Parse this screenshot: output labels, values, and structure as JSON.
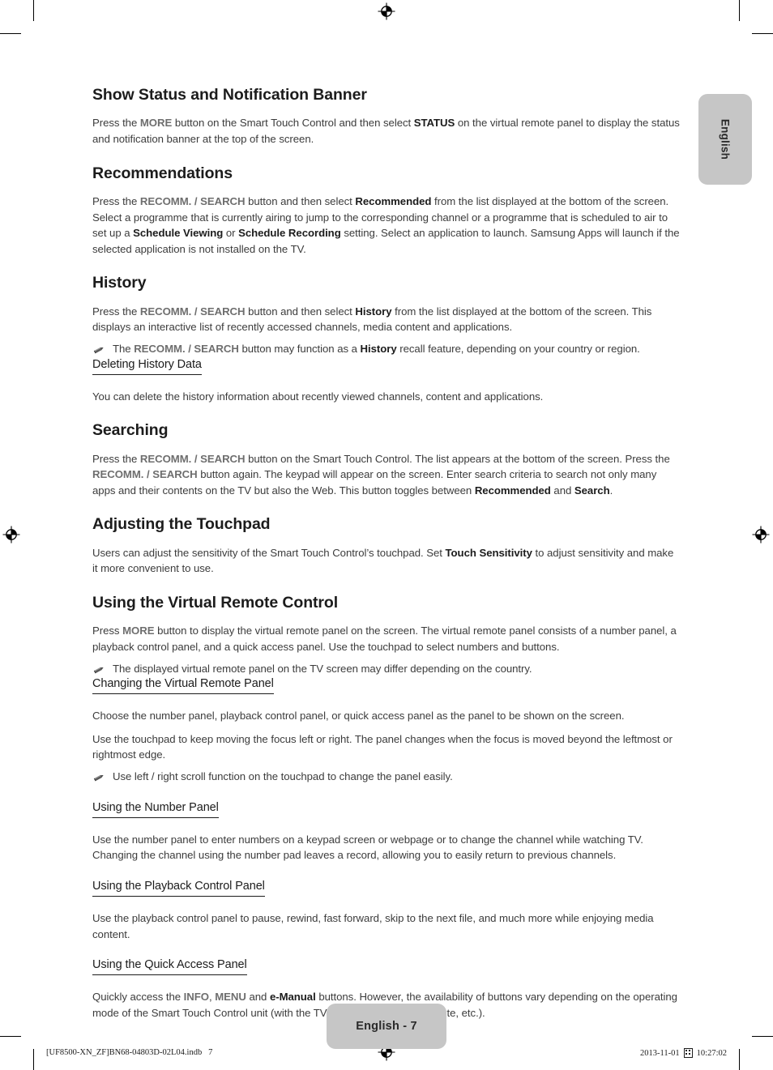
{
  "page": {
    "language_tab": "English",
    "page_badge": "English - 7",
    "imposition_left": "[UF8500-XN_ZF]BN68-04803D-02L04.indb   7",
    "imposition_date": "2013-11-01",
    "imposition_time": "10:27:02",
    "imposition_glyph": "tofu-box-glyph"
  },
  "icons": {
    "note": "note-pencil-icon",
    "registration": "registration-target-icon"
  },
  "sections": [
    {
      "id": "show-status-and-notification-banner",
      "title": "Show Status and Notification Banner",
      "paragraphs": [
        {
          "runs": [
            {
              "t": "Press the ",
              "s": "n"
            },
            {
              "t": "MORE",
              "s": "btn"
            },
            {
              "t": " button on the Smart Touch Control and then select ",
              "s": "n"
            },
            {
              "t": "STATUS",
              "s": "k"
            },
            {
              "t": " on the virtual remote panel to display the status and notification banner at the top of the screen.",
              "s": "n"
            }
          ]
        }
      ]
    },
    {
      "id": "recommendations",
      "title": "Recommendations",
      "paragraphs": [
        {
          "runs": [
            {
              "t": "Press the ",
              "s": "n"
            },
            {
              "t": "RECOMM. / SEARCH",
              "s": "btn"
            },
            {
              "t": " button and then select ",
              "s": "n"
            },
            {
              "t": "Recommended",
              "s": "k"
            },
            {
              "t": " from the list displayed at the bottom of the screen. Select a programme that is currently airing to jump to the corresponding channel or a programme that is scheduled to air to set up a ",
              "s": "n"
            },
            {
              "t": "Schedule Viewing",
              "s": "k"
            },
            {
              "t": " or ",
              "s": "n"
            },
            {
              "t": "Schedule Recording",
              "s": "k"
            },
            {
              "t": " setting. Select an application to launch. Samsung Apps will launch if the selected application is not installed on the TV.",
              "s": "n"
            }
          ]
        }
      ]
    },
    {
      "id": "history",
      "title": "History",
      "paragraphs": [
        {
          "runs": [
            {
              "t": "Press the ",
              "s": "n"
            },
            {
              "t": "RECOMM. / SEARCH",
              "s": "btn"
            },
            {
              "t": " button and then select ",
              "s": "n"
            },
            {
              "t": "History",
              "s": "k"
            },
            {
              "t": " from the list displayed at the bottom of the screen. This displays an interactive list of recently accessed channels, media content and applications.",
              "s": "n"
            }
          ]
        }
      ],
      "notes": [
        {
          "runs": [
            {
              "t": "The ",
              "s": "n"
            },
            {
              "t": "RECOMM. / SEARCH",
              "s": "btn"
            },
            {
              "t": " button may function as a ",
              "s": "n"
            },
            {
              "t": "History",
              "s": "k"
            },
            {
              "t": " recall feature, depending on your country or region.",
              "s": "n"
            }
          ]
        }
      ],
      "subsections": [
        {
          "id": "deleting-history-data",
          "title": "Deleting History Data",
          "paragraphs": [
            {
              "runs": [
                {
                  "t": "You can delete the history information about recently viewed channels, content and applications.",
                  "s": "n"
                }
              ]
            }
          ]
        }
      ]
    },
    {
      "id": "searching",
      "title": "Searching",
      "paragraphs": [
        {
          "runs": [
            {
              "t": "Press the ",
              "s": "n"
            },
            {
              "t": "RECOMM. / SEARCH",
              "s": "btn"
            },
            {
              "t": " button on the Smart Touch Control. The list appears at the bottom of the screen. Press the ",
              "s": "n"
            },
            {
              "t": "RECOMM. / SEARCH",
              "s": "btn"
            },
            {
              "t": " button again. The keypad will appear on the screen. Enter search criteria to search not only many apps and their contents on the TV but also the Web. This button toggles between ",
              "s": "n"
            },
            {
              "t": "Recommended",
              "s": "k"
            },
            {
              "t": " and ",
              "s": "n"
            },
            {
              "t": "Search",
              "s": "k"
            },
            {
              "t": ".",
              "s": "n"
            }
          ]
        }
      ]
    },
    {
      "id": "adjusting-the-touchpad",
      "title": "Adjusting the Touchpad",
      "paragraphs": [
        {
          "runs": [
            {
              "t": "Users can adjust the sensitivity of the Smart Touch Control’s touchpad. Set ",
              "s": "n"
            },
            {
              "t": "Touch Sensitivity",
              "s": "k"
            },
            {
              "t": " to adjust sensitivity and make it more convenient to use.",
              "s": "n"
            }
          ]
        }
      ]
    },
    {
      "id": "using-the-virtual-remote-control",
      "title": "Using the Virtual Remote Control",
      "paragraphs": [
        {
          "runs": [
            {
              "t": "Press ",
              "s": "n"
            },
            {
              "t": "MORE",
              "s": "btn"
            },
            {
              "t": " button to display the virtual remote panel on the screen. The virtual remote panel consists of a number panel, a playback control panel, and a quick access panel. Use the touchpad to select numbers and buttons.",
              "s": "n"
            }
          ]
        }
      ],
      "notes": [
        {
          "runs": [
            {
              "t": "The displayed virtual remote panel on the TV screen may differ depending on the country.",
              "s": "n"
            }
          ]
        }
      ],
      "subsections": [
        {
          "id": "changing-the-virtual-remote-panel",
          "title": "Changing the Virtual Remote Panel",
          "paragraphs": [
            {
              "runs": [
                {
                  "t": "Choose the number panel, playback control panel, or quick access panel as the panel to be shown on the screen.",
                  "s": "n"
                }
              ]
            },
            {
              "runs": [
                {
                  "t": "Use the touchpad to keep moving the focus left or right. The panel changes when the focus is moved beyond the leftmost or rightmost edge.",
                  "s": "n"
                }
              ]
            }
          ],
          "notes": [
            {
              "runs": [
                {
                  "t": "Use left / right scroll function on the touchpad to change the panel easily.",
                  "s": "n"
                }
              ]
            }
          ]
        },
        {
          "id": "using-the-number-panel",
          "title": "Using the Number Panel",
          "paragraphs": [
            {
              "runs": [
                {
                  "t": "Use the number panel to enter numbers on a keypad screen or webpage or to change the channel while watching TV. Changing the channel using the number pad leaves a record, allowing you to easily return to previous channels.",
                  "s": "n"
                }
              ]
            }
          ]
        },
        {
          "id": "using-the-playback-control-panel",
          "title": "Using the Playback Control Panel",
          "paragraphs": [
            {
              "runs": [
                {
                  "t": "Use the playback control panel to pause, rewind, fast forward, skip to the next file, and much more while enjoying media content.",
                  "s": "n"
                }
              ]
            }
          ]
        },
        {
          "id": "using-the-quick-access-panel",
          "title": "Using the Quick Access Panel",
          "paragraphs": [
            {
              "runs": [
                {
                  "t": "Quickly access the ",
                  "s": "n"
                },
                {
                  "t": "INFO",
                  "s": "btn"
                },
                {
                  "t": ", ",
                  "s": "n"
                },
                {
                  "t": "MENU",
                  "s": "btn"
                },
                {
                  "t": " and ",
                  "s": "n"
                },
                {
                  "t": "e-Manual",
                  "s": "k"
                },
                {
                  "t": " buttons. However, the availability of buttons vary depending on the operating mode of the Smart Touch Control unit (with the TV only, as a universal remote, etc.).",
                  "s": "n"
                }
              ]
            }
          ]
        }
      ]
    }
  ]
}
